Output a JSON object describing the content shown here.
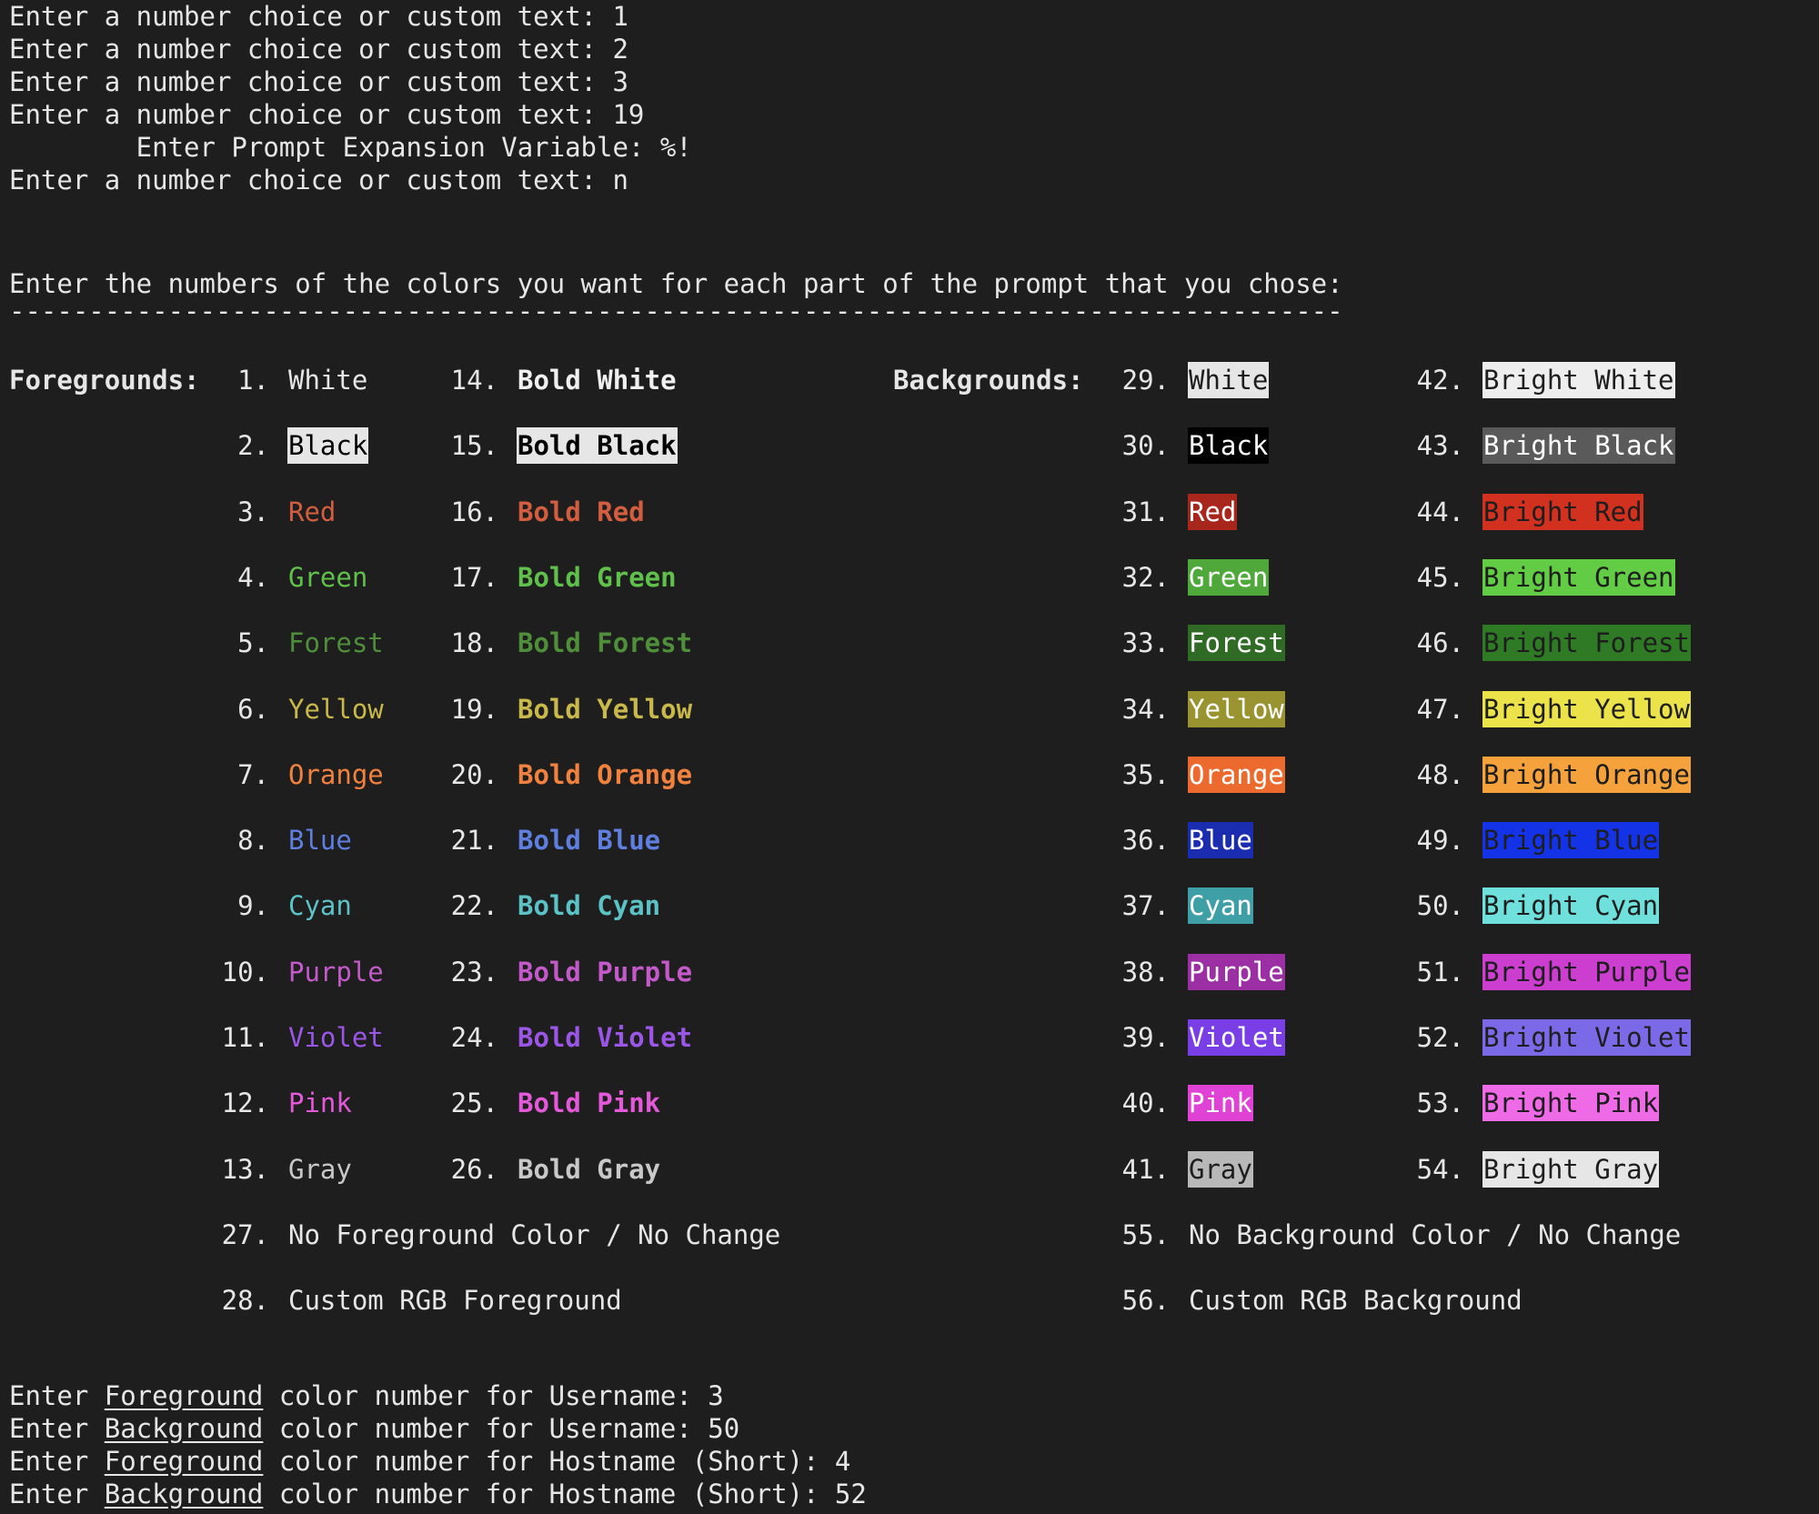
{
  "top_lines": [
    {
      "prompt": "Enter a number choice or custom text: ",
      "value": "1"
    },
    {
      "prompt": "Enter a number choice or custom text: ",
      "value": "2"
    },
    {
      "prompt": "Enter a number choice or custom text: ",
      "value": "3"
    },
    {
      "prompt": "Enter a number choice or custom text: ",
      "value": "19"
    },
    {
      "prompt": "        Enter Prompt Expansion Variable: ",
      "value": "%!"
    },
    {
      "prompt": "Enter a number choice or custom text: ",
      "value": "n"
    }
  ],
  "instruction": "Enter the numbers of the colors you want for each part of the prompt that you chose:",
  "divider": "------------------------------------------------------------------------------------",
  "foregrounds_label": "Foregrounds:",
  "backgrounds_label": "Backgrounds:",
  "fg_col1": [
    {
      "num": "1.",
      "label": "White",
      "color": "#e6e6e6",
      "bg": ""
    },
    {
      "num": "2.",
      "label": "Black",
      "color": "#000000",
      "bg": "#e6e6e6"
    },
    {
      "num": "3.",
      "label": "Red",
      "color": "#d35d3f",
      "bg": ""
    },
    {
      "num": "4.",
      "label": "Green",
      "color": "#5fc04b",
      "bg": ""
    },
    {
      "num": "5.",
      "label": "Forest",
      "color": "#4f8f3a",
      "bg": ""
    },
    {
      "num": "6.",
      "label": "Yellow",
      "color": "#c9b84a",
      "bg": ""
    },
    {
      "num": "7.",
      "label": "Orange",
      "color": "#f0813e",
      "bg": ""
    },
    {
      "num": "8.",
      "label": "Blue",
      "color": "#5f7fe0",
      "bg": ""
    },
    {
      "num": "9.",
      "label": "Cyan",
      "color": "#5bc2c6",
      "bg": ""
    },
    {
      "num": "10.",
      "label": "Purple",
      "color": "#c45ac9",
      "bg": ""
    },
    {
      "num": "11.",
      "label": "Violet",
      "color": "#9b56e8",
      "bg": ""
    },
    {
      "num": "12.",
      "label": "Pink",
      "color": "#e459d9",
      "bg": ""
    },
    {
      "num": "13.",
      "label": "Gray",
      "color": "#c8c8c8",
      "bg": ""
    }
  ],
  "fg_col2": [
    {
      "num": "14.",
      "label": "Bold White",
      "color": "#f0f0f0",
      "bg": ""
    },
    {
      "num": "15.",
      "label": "Bold Black",
      "color": "#000000",
      "bg": "#e6e6e6"
    },
    {
      "num": "16.",
      "label": "Bold Red",
      "color": "#d35d3f",
      "bg": ""
    },
    {
      "num": "17.",
      "label": "Bold Green",
      "color": "#5fc04b",
      "bg": ""
    },
    {
      "num": "18.",
      "label": "Bold Forest",
      "color": "#4f8f3a",
      "bg": ""
    },
    {
      "num": "19.",
      "label": "Bold Yellow",
      "color": "#c9b84a",
      "bg": ""
    },
    {
      "num": "20.",
      "label": "Bold Orange",
      "color": "#f0813e",
      "bg": ""
    },
    {
      "num": "21.",
      "label": "Bold Blue",
      "color": "#5f7fe0",
      "bg": ""
    },
    {
      "num": "22.",
      "label": "Bold Cyan",
      "color": "#5bc2c6",
      "bg": ""
    },
    {
      "num": "23.",
      "label": "Bold Purple",
      "color": "#c45ac9",
      "bg": ""
    },
    {
      "num": "24.",
      "label": "Bold Violet",
      "color": "#9b56e8",
      "bg": ""
    },
    {
      "num": "25.",
      "label": "Bold Pink",
      "color": "#e459d9",
      "bg": ""
    },
    {
      "num": "26.",
      "label": "Bold Gray",
      "color": "#c8c8c8",
      "bg": ""
    }
  ],
  "bg_col1": [
    {
      "num": "29.",
      "label": "White",
      "color": "#1e1e1e",
      "bg": "#e6e6e6"
    },
    {
      "num": "30.",
      "label": "Black",
      "color": "#ffffff",
      "bg": "#000000"
    },
    {
      "num": "31.",
      "label": "Red",
      "color": "#ffffff",
      "bg": "#a8261b"
    },
    {
      "num": "32.",
      "label": "Green",
      "color": "#ffffff",
      "bg": "#4ea83a"
    },
    {
      "num": "33.",
      "label": "Forest",
      "color": "#ffffff",
      "bg": "#2f6b25"
    },
    {
      "num": "34.",
      "label": "Yellow",
      "color": "#ffffff",
      "bg": "#9a9430"
    },
    {
      "num": "35.",
      "label": "Orange",
      "color": "#ffffff",
      "bg": "#ec6a2e"
    },
    {
      "num": "36.",
      "label": "Blue",
      "color": "#ffffff",
      "bg": "#1a2cb0"
    },
    {
      "num": "37.",
      "label": "Cyan",
      "color": "#ffffff",
      "bg": "#3f9fa7"
    },
    {
      "num": "38.",
      "label": "Purple",
      "color": "#ffffff",
      "bg": "#9c2fa3"
    },
    {
      "num": "39.",
      "label": "Violet",
      "color": "#ffffff",
      "bg": "#7a3ee6"
    },
    {
      "num": "40.",
      "label": "Pink",
      "color": "#ffffff",
      "bg": "#e042d6"
    },
    {
      "num": "41.",
      "label": "Gray",
      "color": "#1e1e1e",
      "bg": "#b8b8b8"
    }
  ],
  "bg_col2": [
    {
      "num": "42.",
      "label": "Bright White",
      "color": "#1e1e1e",
      "bg": "#eeeeee"
    },
    {
      "num": "43.",
      "label": "Bright Black",
      "color": "#ffffff",
      "bg": "#5a5a5a"
    },
    {
      "num": "44.",
      "label": "Bright Red",
      "color": "#1e1e1e",
      "bg": "#d2311f"
    },
    {
      "num": "45.",
      "label": "Bright Green",
      "color": "#1e1e1e",
      "bg": "#62cc45"
    },
    {
      "num": "46.",
      "label": "Bright Forest",
      "color": "#1e1e1e",
      "bg": "#2f7a25"
    },
    {
      "num": "47.",
      "label": "Bright Yellow",
      "color": "#1e1e1e",
      "bg": "#ece34a"
    },
    {
      "num": "48.",
      "label": "Bright Orange",
      "color": "#1e1e1e",
      "bg": "#f5a23c"
    },
    {
      "num": "49.",
      "label": "Bright Blue",
      "color": "#1e1e1e",
      "bg": "#1533e6"
    },
    {
      "num": "50.",
      "label": "Bright Cyan",
      "color": "#1e1e1e",
      "bg": "#6fe0dc"
    },
    {
      "num": "51.",
      "label": "Bright Purple",
      "color": "#1e1e1e",
      "bg": "#cc3ed0"
    },
    {
      "num": "52.",
      "label": "Bright Violet",
      "color": "#1e1e1e",
      "bg": "#7a6ae8"
    },
    {
      "num": "53.",
      "label": "Bright Pink",
      "color": "#1e1e1e",
      "bg": "#ee6ae6"
    },
    {
      "num": "54.",
      "label": "Bright Gray",
      "color": "#1e1e1e",
      "bg": "#e6e6e6"
    }
  ],
  "fg_extra": [
    {
      "num": "27.",
      "label": "No Foreground Color / No Change"
    },
    {
      "num": "28.",
      "label": "Custom RGB Foreground"
    }
  ],
  "bg_extra": [
    {
      "num": "55.",
      "label": "No Background Color / No Change"
    },
    {
      "num": "56.",
      "label": "Custom RGB Background"
    }
  ],
  "bottom_lines": [
    {
      "pre": "Enter ",
      "kind": "Foreground",
      "post": " color number for Username: ",
      "value": "3"
    },
    {
      "pre": "Enter ",
      "kind": "Background",
      "post": " color number for Username: ",
      "value": "50"
    },
    {
      "pre": "Enter ",
      "kind": "Foreground",
      "post": " color number for Hostname (Short): ",
      "value": "4"
    },
    {
      "pre": "Enter ",
      "kind": "Background",
      "post": " color number for Hostname (Short): ",
      "value": "52"
    }
  ]
}
